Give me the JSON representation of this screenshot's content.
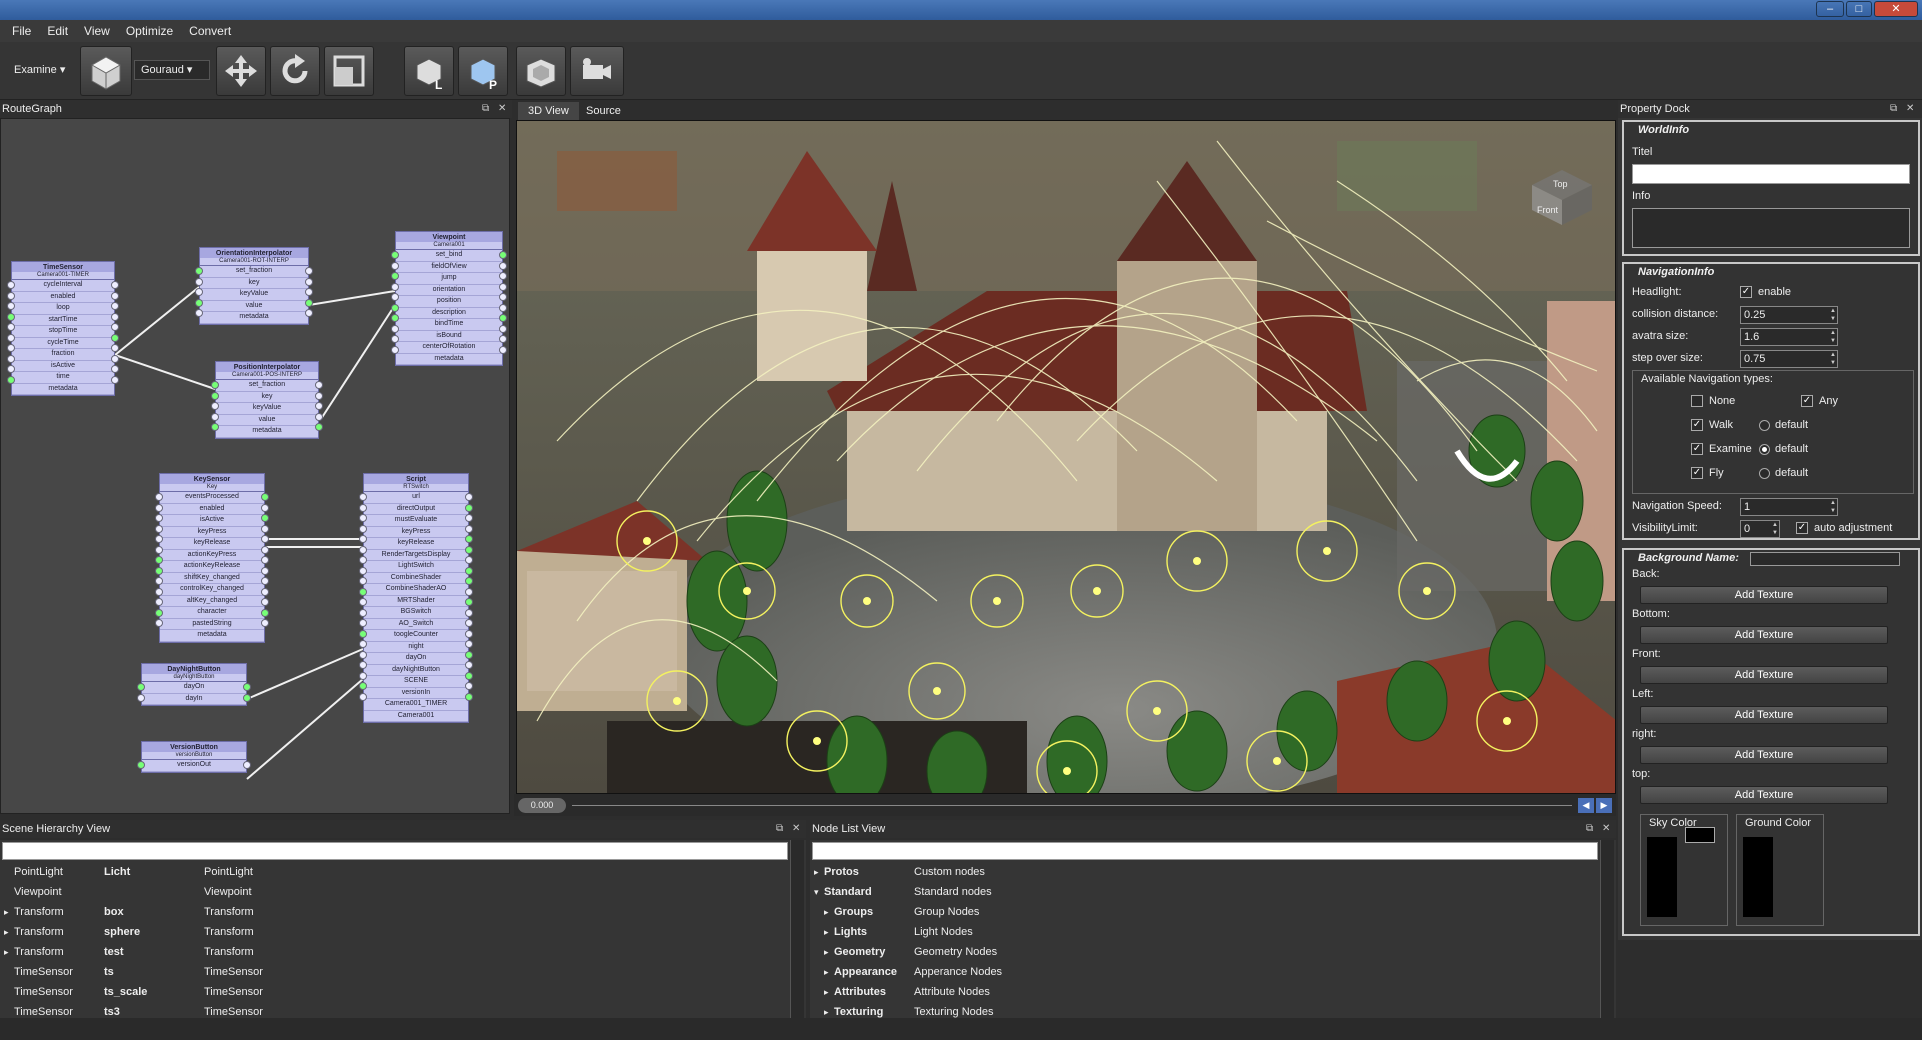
{
  "window": {
    "min": "–",
    "max": "□",
    "close": "✕"
  },
  "menu": [
    "File",
    "Edit",
    "View",
    "Optimize",
    "Convert"
  ],
  "toolbar": {
    "nav_mode": "Examine",
    "shading": "Gouraud",
    "icons": [
      "examine-cube-icon",
      "move-icon",
      "rotate-icon",
      "scale-icon",
      "light-cube-icon",
      "perspective-cube-icon",
      "ortho-cube-icon",
      "camera-icon"
    ]
  },
  "routegraph": {
    "title": "RouteGraph",
    "nodes": [
      {
        "title": "TimeSensor",
        "sub": "Camera001-TIMER",
        "ports": [
          "cycleInterval",
          "enabled",
          "loop",
          "startTime",
          "stopTime",
          "cycleTime",
          "fraction",
          "isActive",
          "time",
          "metadata"
        ]
      },
      {
        "title": "OrientationInterpolator",
        "sub": "Camera001-ROT-INTERP",
        "ports": [
          "set_fraction",
          "key",
          "keyValue",
          "value",
          "metadata"
        ]
      },
      {
        "title": "Viewpoint",
        "sub": "Camera001",
        "ports": [
          "set_bind",
          "fieldOfView",
          "jump",
          "orientation",
          "position",
          "description",
          "bindTime",
          "isBound",
          "centerOfRotation",
          "metadata"
        ]
      },
      {
        "title": "PositionInterpolator",
        "sub": "Camera001-POS-INTERP",
        "ports": [
          "set_fraction",
          "key",
          "keyValue",
          "value",
          "metadata"
        ]
      },
      {
        "title": "KeySensor",
        "sub": "Key",
        "ports": [
          "eventsProcessed",
          "enabled",
          "isActive",
          "keyPress",
          "keyRelease",
          "actionKeyPress",
          "actionKeyRelease",
          "shiftKey_changed",
          "controlKey_changed",
          "altKey_changed",
          "character",
          "pastedString",
          "metadata"
        ]
      },
      {
        "title": "Script",
        "sub": "RTSwitch",
        "ports": [
          "url",
          "directOutput",
          "mustEvaluate",
          "keyPress",
          "keyRelease",
          "RenderTargetsDisplay",
          "LightSwitch",
          "CombineShader",
          "CombineShaderAO",
          "MRTShader",
          "BGSwitch",
          "AO_Switch",
          "toogleCounter",
          "night",
          "dayOn",
          "dayNightButton",
          "SCENE",
          "versionIn",
          "Camera001_TIMER",
          "Camera001"
        ]
      },
      {
        "title": "DayNightButton",
        "sub": "dayNightButton",
        "ports": [
          "dayOn",
          "dayIn"
        ]
      },
      {
        "title": "VersionButton",
        "sub": "versionButton",
        "ports": [
          "versionOut"
        ]
      }
    ]
  },
  "view": {
    "tabs": [
      "3D View",
      "Source"
    ],
    "time": "0.000",
    "cube": {
      "top": "Top",
      "front": "Front"
    }
  },
  "property": {
    "title": "Property Dock",
    "world": {
      "title": "WorldInfo",
      "titel": "Titel",
      "info": "Info"
    },
    "nav": {
      "title": "NavigationInfo",
      "headlight": "Headlight:",
      "enable": "enable",
      "collision": "collision distance:",
      "collision_v": "0.25",
      "avatar": "avatra size:",
      "avatar_v": "1.6",
      "step": "step over size:",
      "step_v": "0.75",
      "types": "Available Navigation types:",
      "none": "None",
      "any": "Any",
      "walk": "Walk",
      "examine": "Examine",
      "fly": "Fly",
      "default": "default",
      "speed": "Navigation Speed:",
      "speed_v": "1",
      "vis": "VisibilityLimit:",
      "vis_v": "0",
      "auto": "auto adjustment"
    },
    "bg": {
      "title": "Background Name:",
      "sides": [
        "Back:",
        "Bottom:",
        "Front:",
        "Left:",
        "right:",
        "top:"
      ],
      "add": "Add Texture",
      "sky": "Sky Color",
      "ground": "Ground Color"
    }
  },
  "scene": {
    "title": "Scene Hierarchy View",
    "rows": [
      [
        "PointLight",
        "Licht",
        "PointLight",
        false
      ],
      [
        "Viewpoint",
        "",
        "Viewpoint",
        false
      ],
      [
        "Transform",
        "box",
        "Transform",
        true
      ],
      [
        "Transform",
        "sphere",
        "Transform",
        true
      ],
      [
        "Transform",
        "test",
        "Transform",
        true
      ],
      [
        "TimeSensor",
        "ts",
        "TimeSensor",
        false
      ],
      [
        "TimeSensor",
        "ts_scale",
        "TimeSensor",
        false
      ],
      [
        "TimeSensor",
        "ts3",
        "TimeSensor",
        false
      ]
    ]
  },
  "nodelist": {
    "title": "Node List View",
    "rows": [
      [
        "Protos",
        "Custom nodes",
        "▸",
        0
      ],
      [
        "Standard",
        "Standard nodes",
        "▾",
        0
      ],
      [
        "Groups",
        "Group Nodes",
        "▸",
        1
      ],
      [
        "Lights",
        "Light Nodes",
        "▸",
        1
      ],
      [
        "Geometry",
        "Geometry Nodes",
        "▸",
        1
      ],
      [
        "Appearance",
        "Apperance Nodes",
        "▸",
        1
      ],
      [
        "Attributes",
        "Attribute Nodes",
        "▸",
        1
      ],
      [
        "Texturing",
        "Texturing Nodes",
        "▸",
        1
      ]
    ]
  }
}
